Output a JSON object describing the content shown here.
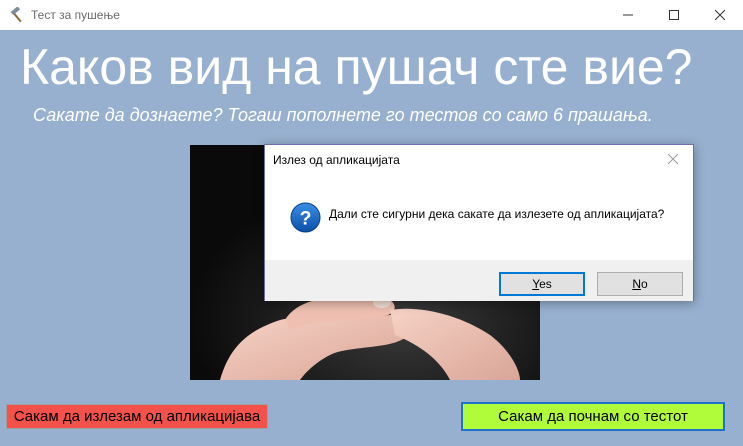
{
  "window": {
    "title": "Тест за пушење",
    "icon": "hammer-icon"
  },
  "main": {
    "headline": "Каков вид на пушач сте вие?",
    "subtitle": "Сакате да дознаете? Тогаш пополнете го тестов со само 6 прашања.",
    "image": "hand-holding-cigarette-photo",
    "background_color": "#97b0cf"
  },
  "buttons": {
    "exit_label": "Сакам да излезам од апликацијава",
    "exit_color": "#f2524a",
    "start_label": "Сакам да почнам со тестот",
    "start_color": "#b0fb3a"
  },
  "dialog": {
    "title": "Излез од апликацијата",
    "message": "Дали сте сигурни дека сакате да излезете од апликацијата?",
    "icon": "question-icon",
    "yes_first": "Y",
    "yes_rest": "es",
    "no_first": "N",
    "no_rest": "o"
  }
}
